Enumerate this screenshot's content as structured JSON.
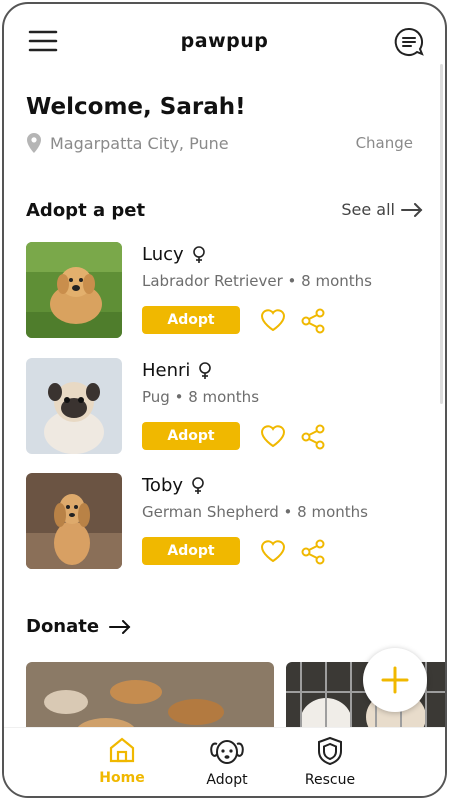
{
  "app": {
    "title": "pawpup"
  },
  "header": {
    "welcome": "Welcome, Sarah!",
    "location": "Magarpatta City, Pune",
    "change_label": "Change"
  },
  "adopt_section": {
    "title": "Adopt a pet",
    "see_all": "See all"
  },
  "pets": [
    {
      "name": "Lucy",
      "meta": "Labrador Retriever • 8 months",
      "adopt_label": "Adopt"
    },
    {
      "name": "Henri",
      "meta": "Pug • 8 months",
      "adopt_label": "Adopt"
    },
    {
      "name": "Toby",
      "meta": "German Shepherd • 8 months",
      "adopt_label": "Adopt"
    }
  ],
  "donate": {
    "title": "Donate"
  },
  "bottom_nav": [
    {
      "label": "Home",
      "icon": "home-icon",
      "active": true
    },
    {
      "label": "Adopt",
      "icon": "dog-icon",
      "active": false
    },
    {
      "label": "Rescue",
      "icon": "shield-icon",
      "active": false
    }
  ],
  "colors": {
    "accent": "#f0b800",
    "muted": "#8a8a8a"
  }
}
